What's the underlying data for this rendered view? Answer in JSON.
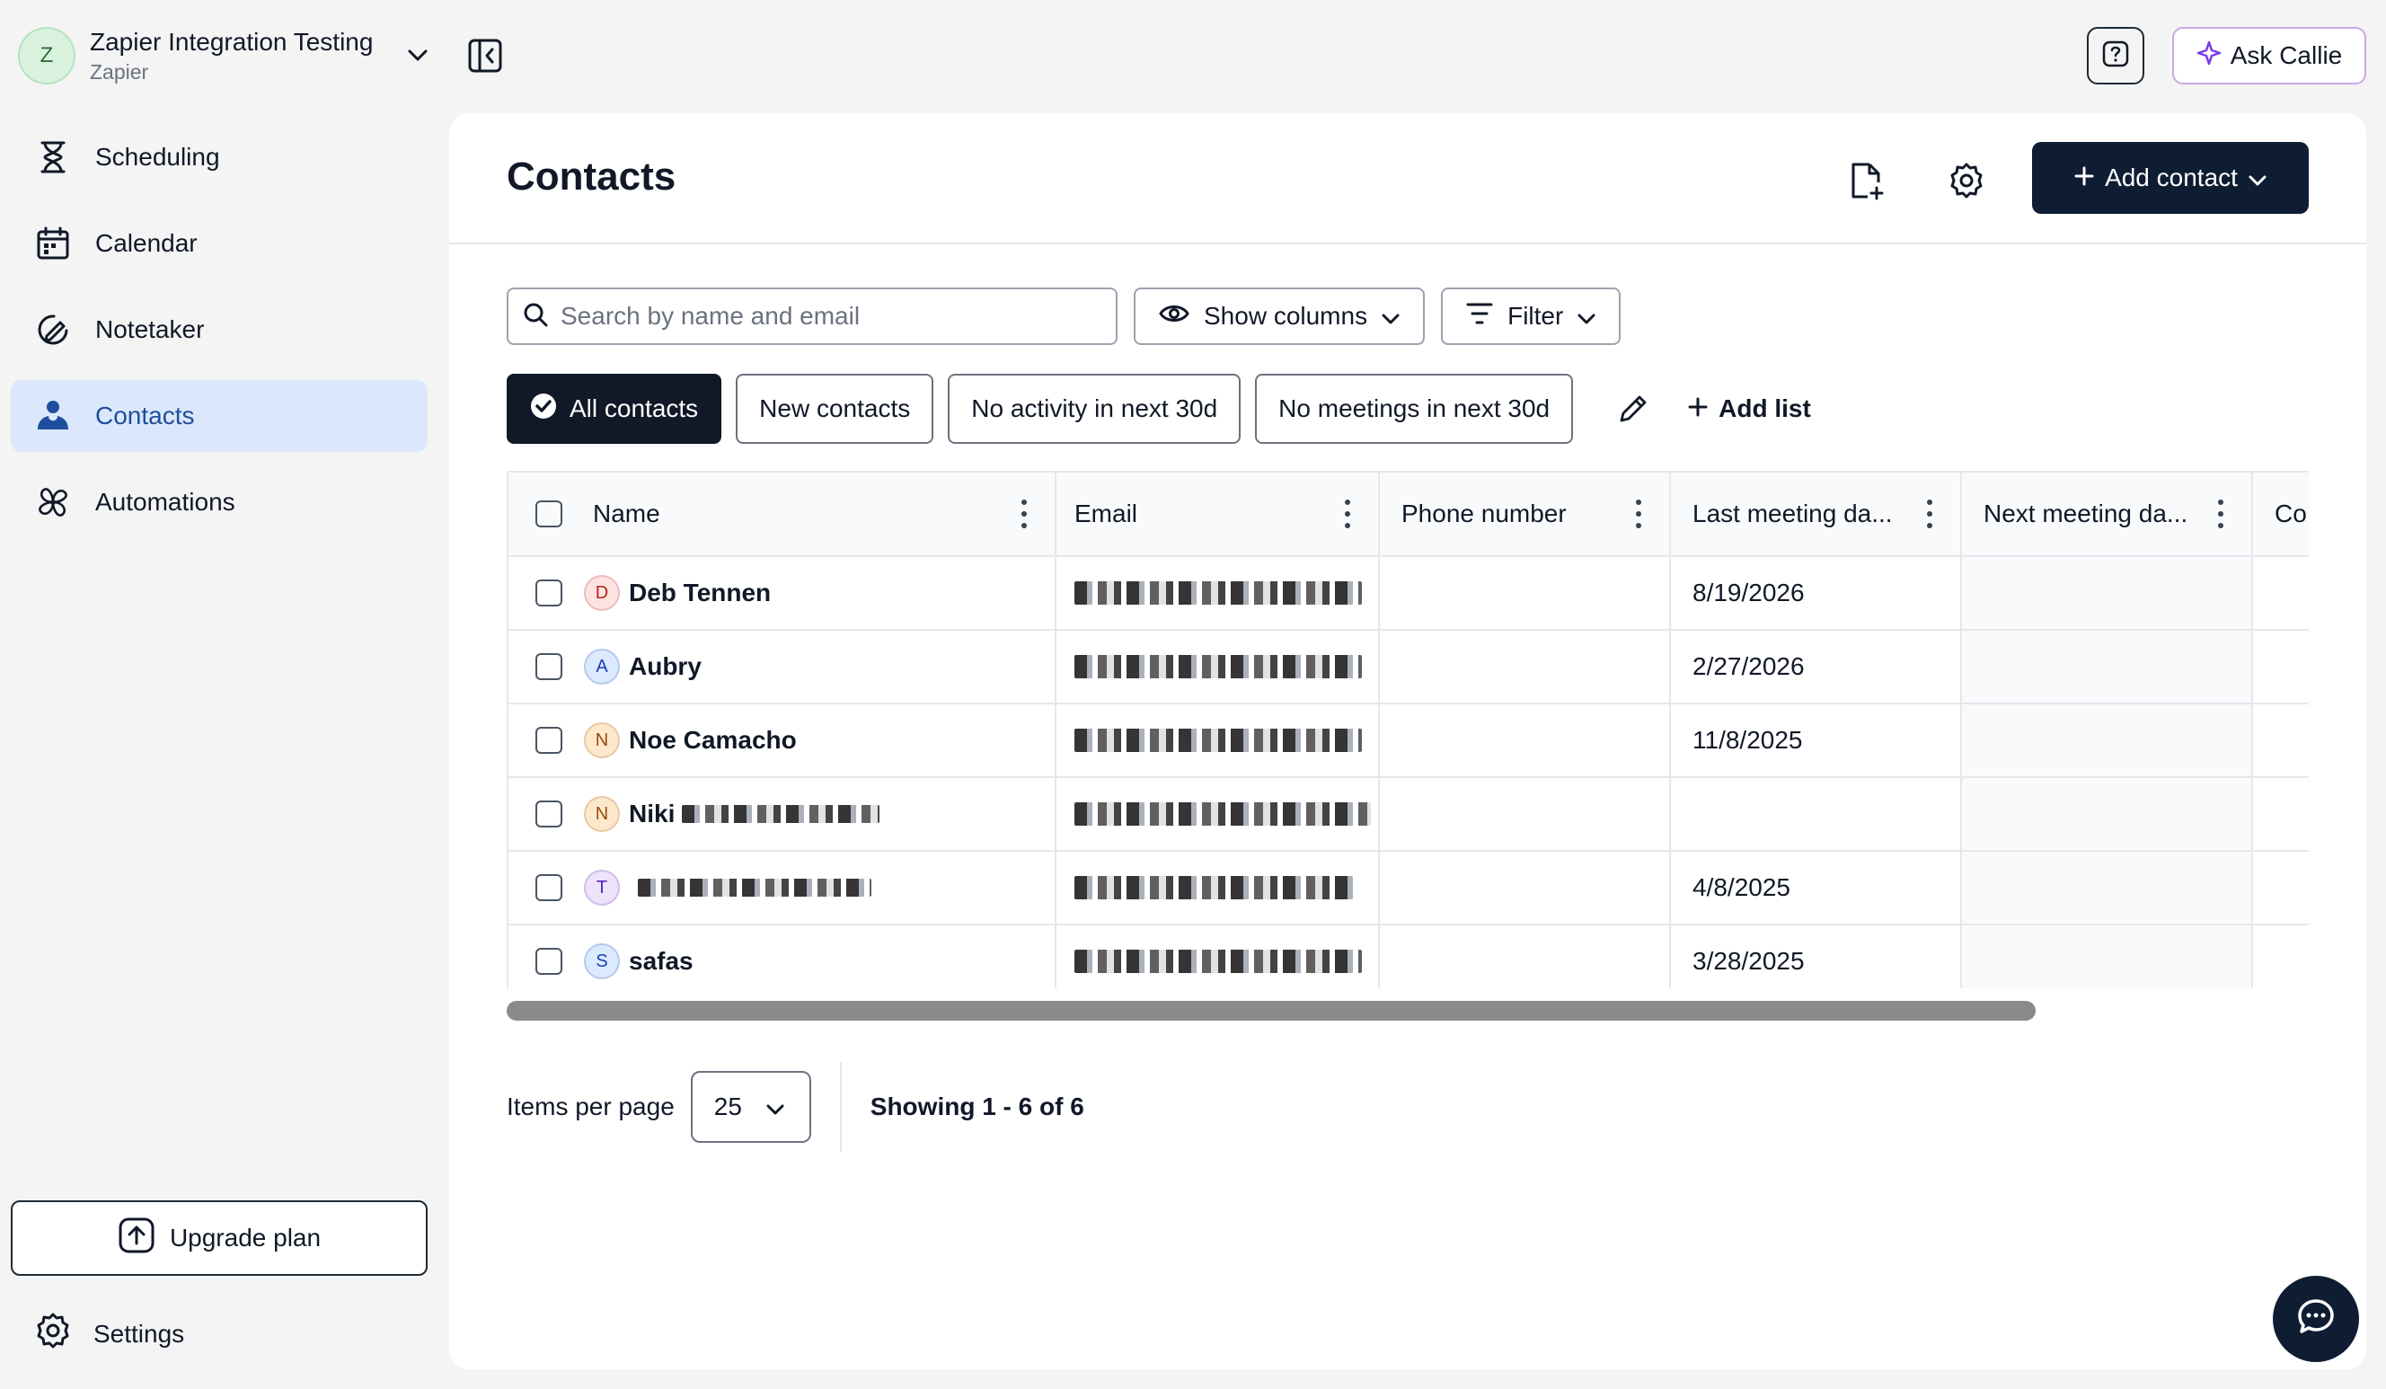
{
  "workspace": {
    "initial": "Z",
    "name": "Zapier Integration Testing",
    "sub": "Zapier"
  },
  "sidebar": {
    "items": [
      {
        "label": "Scheduling",
        "icon": "hourglass-icon"
      },
      {
        "label": "Calendar",
        "icon": "calendar-icon"
      },
      {
        "label": "Notetaker",
        "icon": "notetaker-icon"
      },
      {
        "label": "Contacts",
        "icon": "contacts-icon",
        "active": true
      },
      {
        "label": "Automations",
        "icon": "automations-icon"
      }
    ],
    "upgrade_label": "Upgrade plan",
    "settings_label": "Settings"
  },
  "topbar": {
    "ask_label": "Ask Callie"
  },
  "main": {
    "title": "Contacts",
    "add_contact_label": "Add contact",
    "search_placeholder": "Search by name and email",
    "show_columns_label": "Show columns",
    "filter_label": "Filter",
    "lists": [
      "All contacts",
      "New contacts",
      "No activity in next 30d",
      "No meetings in next 30d"
    ],
    "add_list_label": "Add list"
  },
  "table": {
    "columns": [
      "Name",
      "Email",
      "Phone number",
      "Last meeting da...",
      "Next meeting da...",
      "Co"
    ],
    "rows": [
      {
        "initial": "D",
        "name": "Deb Tennen",
        "last_meeting": "8/19/2026",
        "avatar_bg": "#fde2e2",
        "avatar_fg": "#b42318"
      },
      {
        "initial": "A",
        "name": "Aubry",
        "last_meeting": "2/27/2026",
        "avatar_bg": "#dbeafe",
        "avatar_fg": "#1e40af"
      },
      {
        "initial": "N",
        "name": "Noe Camacho",
        "last_meeting": "11/8/2025",
        "avatar_bg": "#fde8cc",
        "avatar_fg": "#9a4b06"
      },
      {
        "initial": "N",
        "name": "Niki",
        "last_meeting": "",
        "avatar_bg": "#fde8cc",
        "avatar_fg": "#9a4b06"
      },
      {
        "initial": "T",
        "name": "",
        "last_meeting": "4/8/2025",
        "avatar_bg": "#ede4fb",
        "avatar_fg": "#5b21b6"
      },
      {
        "initial": "S",
        "name": "safas",
        "last_meeting": "3/28/2025",
        "avatar_bg": "#dbeafe",
        "avatar_fg": "#1e40af"
      }
    ]
  },
  "pager": {
    "items_label": "Items per page",
    "per_page": "25",
    "showing": "Showing 1 - 6 of 6"
  },
  "colors": {
    "primary": "#0f1d33",
    "active_nav": "#dbe7fb",
    "callie_border": "#c9a9e6"
  }
}
